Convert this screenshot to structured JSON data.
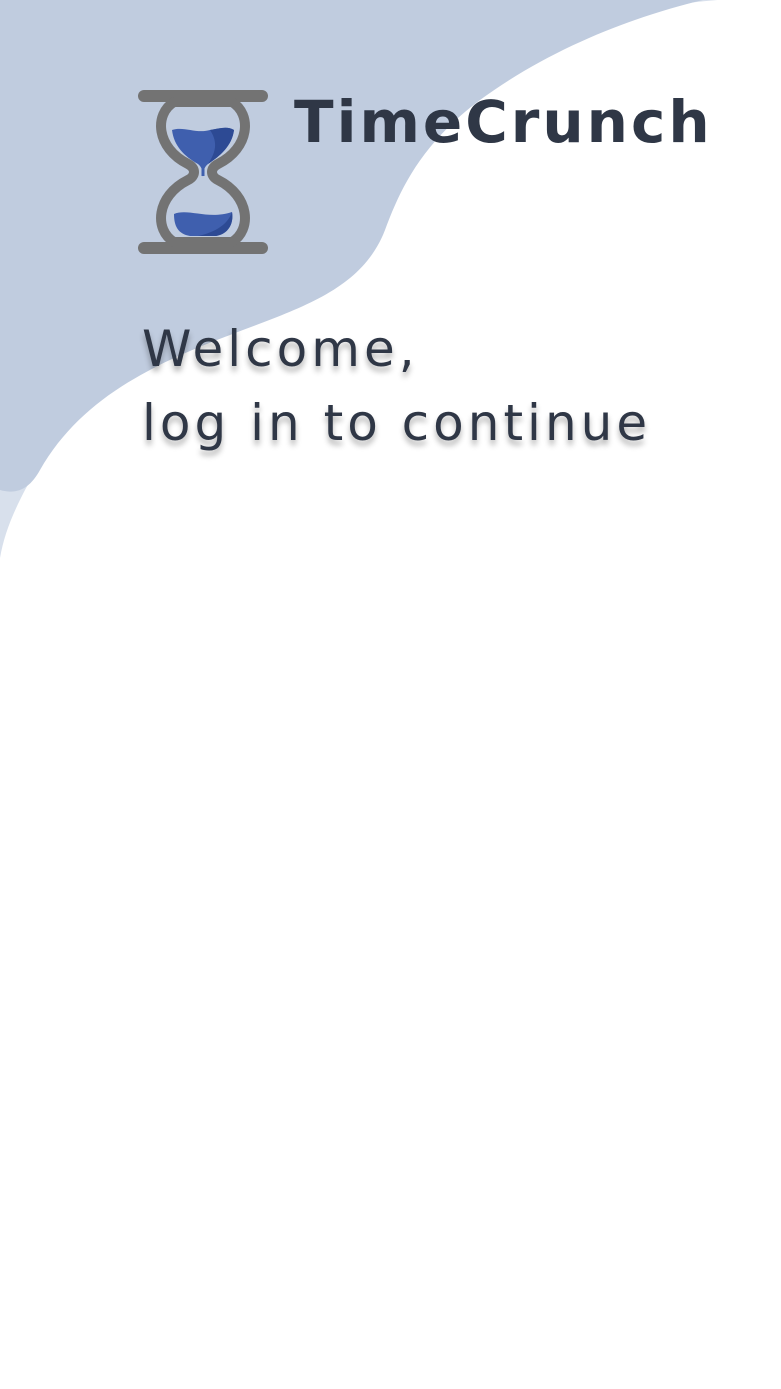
{
  "app": {
    "name": "TimeCrunch",
    "logo_icon": "hourglass-icon"
  },
  "greeting": {
    "line1": "Welcome,",
    "line2": "log in to continue"
  },
  "colors": {
    "background": "#ffffff",
    "wave_dark": "#c0ccdf",
    "wave_light": "#d8e0ec",
    "text": "#2f3746",
    "hourglass_frame": "#737373",
    "sand": "#3f5fae"
  }
}
